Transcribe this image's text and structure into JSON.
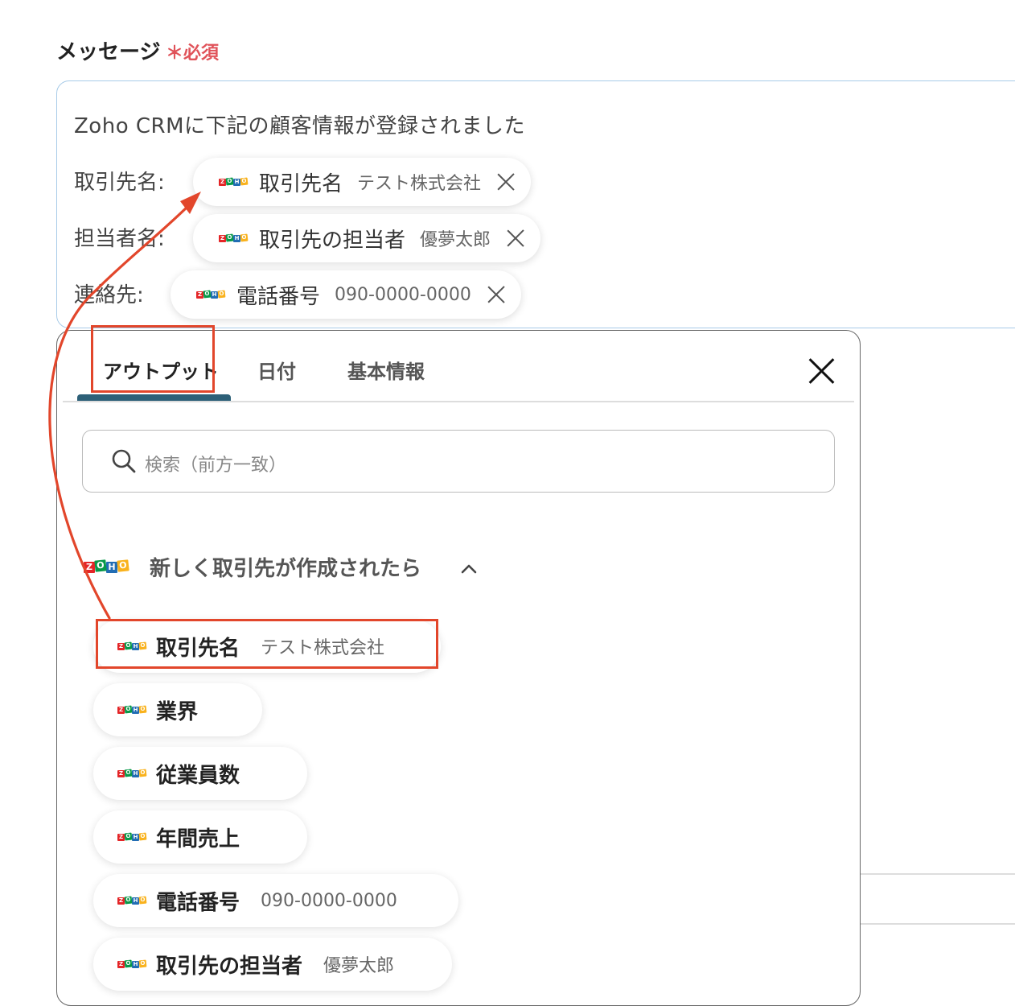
{
  "field": {
    "label": "メッセージ",
    "required_mark": "＊",
    "required_text": "必須"
  },
  "message": {
    "line1": "Zoho CRMに下記の顧客情報が登録されました",
    "rows": [
      {
        "label": "取引先名:",
        "chip_name": "取引先名",
        "chip_value": "テスト株式会社"
      },
      {
        "label": "担当者名:",
        "chip_name": "取引先の担当者",
        "chip_value": "優夢太郎"
      },
      {
        "label": "連絡先:",
        "chip_name": "電話番号",
        "chip_value": "090-0000-0000"
      }
    ]
  },
  "picker": {
    "tabs": [
      {
        "label": "アウトプット",
        "active": true
      },
      {
        "label": "日付",
        "active": false
      },
      {
        "label": "基本情報",
        "active": false
      }
    ],
    "search_placeholder": "検索（前方一致）",
    "group_title": "新しく取引先が作成されたら",
    "items": [
      {
        "name": "取引先名",
        "value": "テスト株式会社"
      },
      {
        "name": "業界",
        "value": ""
      },
      {
        "name": "従業員数",
        "value": ""
      },
      {
        "name": "年間売上",
        "value": ""
      },
      {
        "name": "電話番号",
        "value": "090-0000-0000"
      },
      {
        "name": "取引先の担当者",
        "value": "優夢太郎"
      }
    ]
  },
  "logo_text": "ZOHO",
  "colors": {
    "accent": "#2d6078",
    "highlight": "#e2462b",
    "required": "#e0535a",
    "border": "#a8cbe8"
  },
  "icons": [
    "zoho-logo-icon",
    "close-icon",
    "search-icon",
    "chevron-up-icon",
    "arrow-annotation"
  ]
}
